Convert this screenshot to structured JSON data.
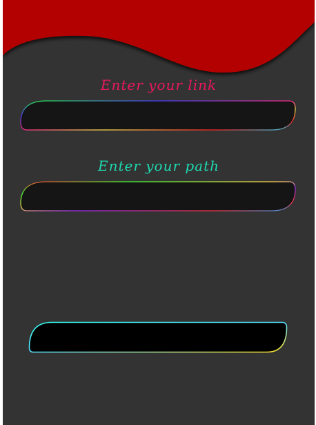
{
  "form": {
    "link_label": "Enter your link",
    "link_value": "",
    "path_label": "Enter your path",
    "path_value": "",
    "submit_label": ""
  },
  "colors": {
    "background": "#333333",
    "header_red": "#b30000",
    "link_label": "#e8185f",
    "path_label": "#1fd9b0",
    "field_fill": "#151515",
    "button_fill": "#000000"
  }
}
